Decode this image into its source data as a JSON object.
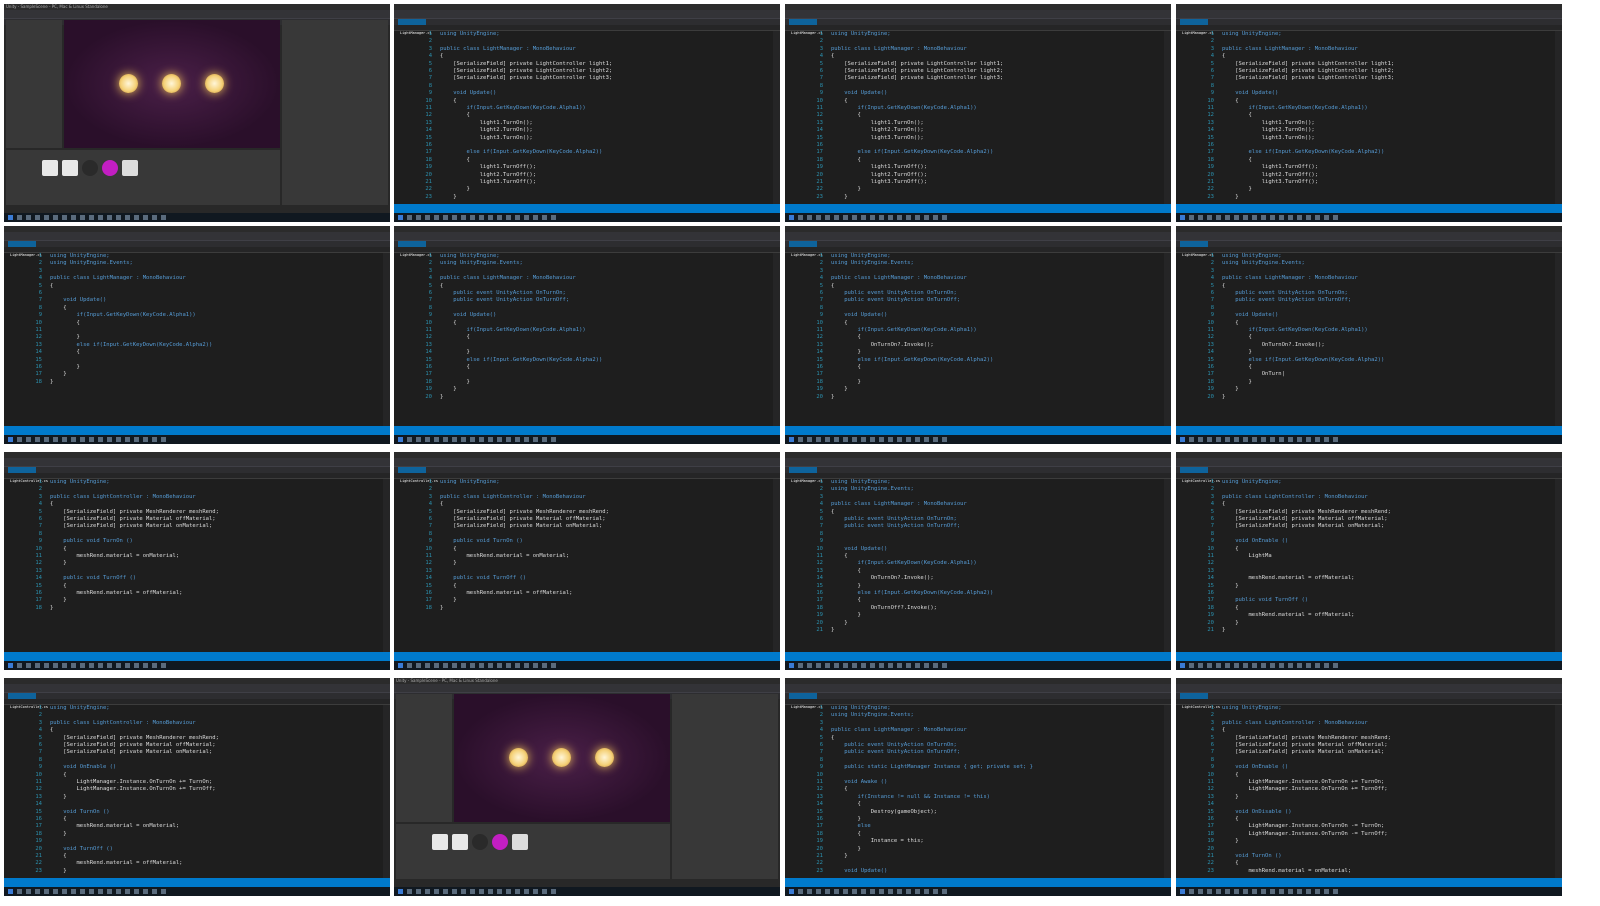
{
  "window": {
    "title": "LightManager.cs - Visual Studio"
  },
  "unity_tiles": [
    {
      "id": "unity-1",
      "title": "Unity - SampleScene - PC, Mac & Linux Standalone"
    },
    {
      "id": "unity-2",
      "title": "Unity - SampleScene - PC, Mac & Linux Standalone"
    }
  ],
  "code_tiles": [
    {
      "id": "code-1",
      "file": "LightManager.cs",
      "start": 1,
      "lines": [
        "using UnityEngine;",
        "",
        "public class LightManager : MonoBehaviour",
        "{",
        "    [SerializeField] private LightController light1;",
        "    [SerializeField] private LightController light2;",
        "    [SerializeField] private LightController light3;",
        "",
        "    void Update()",
        "    {",
        "        if(Input.GetKeyDown(KeyCode.Alpha1))",
        "        {",
        "            light1.TurnOn();",
        "            light2.TurnOn();",
        "            light3.TurnOn();",
        "",
        "        else if(Input.GetKeyDown(KeyCode.Alpha2))",
        "        {",
        "            light1.TurnOff();",
        "            light2.TurnOff();",
        "            light3.TurnOff();",
        "        }",
        "    }"
      ]
    },
    {
      "id": "code-2",
      "file": "LightManager.cs",
      "start": 1,
      "lines": [
        "using UnityEngine;",
        "",
        "public class LightManager : MonoBehaviour",
        "{",
        "    [SerializeField] private LightController light1;",
        "    [SerializeField] private LightController light2;",
        "    [SerializeField] private LightController light3;",
        "",
        "    void Update()",
        "    {",
        "        if(Input.GetKeyDown(KeyCode.Alpha1))",
        "        {",
        "            light1.TurnOn();",
        "            light2.TurnOn();",
        "            light3.TurnOn();",
        "",
        "        else if(Input.GetKeyDown(KeyCode.Alpha2))",
        "        {",
        "            light1.TurnOff();",
        "            light2.TurnOff();",
        "            light3.TurnOff();",
        "        }",
        "    }"
      ]
    },
    {
      "id": "code-3",
      "file": "LightManager.cs",
      "start": 1,
      "lines": [
        "using UnityEngine;",
        "",
        "public class LightManager : MonoBehaviour",
        "{",
        "    [SerializeField] private LightController light1;",
        "    [SerializeField] private LightController light2;",
        "    [SerializeField] private LightController light3;",
        "",
        "    void Update()",
        "    {",
        "        if(Input.GetKeyDown(KeyCode.Alpha1))",
        "        {",
        "            light1.TurnOn();",
        "            light2.TurnOn();",
        "            light3.TurnOn();",
        "",
        "        else if(Input.GetKeyDown(KeyCode.Alpha2))",
        "        {",
        "            light1.TurnOff();",
        "            light2.TurnOff();",
        "            light3.TurnOff();",
        "        }",
        "    }"
      ]
    },
    {
      "id": "code-4",
      "file": "LightManager.cs",
      "start": 1,
      "lines": [
        "using UnityEngine;",
        "using UnityEngine.Events;",
        "",
        "public class LightManager : MonoBehaviour",
        "{",
        "",
        "    void Update()",
        "    {",
        "        if(Input.GetKeyDown(KeyCode.Alpha1))",
        "        {",
        "",
        "        }",
        "        else if(Input.GetKeyDown(KeyCode.Alpha2))",
        "        {",
        "",
        "        }",
        "    }",
        "}"
      ]
    },
    {
      "id": "code-5",
      "file": "LightManager.cs",
      "start": 1,
      "lines": [
        "using UnityEngine;",
        "using UnityEngine.Events;",
        "",
        "public class LightManager : MonoBehaviour",
        "{",
        "    public event UnityAction OnTurnOn;",
        "    public event UnityAction OnTurnOff;",
        "",
        "    void Update()",
        "    {",
        "        if(Input.GetKeyDown(KeyCode.Alpha1))",
        "        {",
        "",
        "        }",
        "        else if(Input.GetKeyDown(KeyCode.Alpha2))",
        "        {",
        "",
        "        }",
        "    }",
        "}"
      ]
    },
    {
      "id": "code-6",
      "file": "LightManager.cs",
      "start": 1,
      "lines": [
        "using UnityEngine;",
        "using UnityEngine.Events;",
        "",
        "public class LightManager : MonoBehaviour",
        "{",
        "    public event UnityAction OnTurnOn;",
        "    public event UnityAction OnTurnOff;",
        "",
        "    void Update()",
        "    {",
        "        if(Input.GetKeyDown(KeyCode.Alpha1))",
        "        {",
        "            OnTurnOn?.Invoke();",
        "        }",
        "        else if(Input.GetKeyDown(KeyCode.Alpha2))",
        "        {",
        "",
        "        }",
        "    }",
        "}"
      ]
    },
    {
      "id": "code-7",
      "file": "LightManager.cs",
      "start": 1,
      "lines": [
        "using UnityEngine;",
        "using UnityEngine.Events;",
        "",
        "public class LightManager : MonoBehaviour",
        "{",
        "    public event UnityAction OnTurnOn;",
        "    public event UnityAction OnTurnOff;",
        "",
        "    void Update()",
        "    {",
        "        if(Input.GetKeyDown(KeyCode.Alpha1))",
        "        {",
        "            OnTurnOn?.Invoke();",
        "        }",
        "        else if(Input.GetKeyDown(KeyCode.Alpha2))",
        "        {",
        "            OnTurn|",
        "        }",
        "    }",
        "}"
      ]
    },
    {
      "id": "code-8",
      "file": "LightController.cs",
      "start": 1,
      "lines": [
        "using UnityEngine;",
        "",
        "public class LightController : MonoBehaviour",
        "{",
        "    [SerializeField] private MeshRenderer meshRend;",
        "    [SerializeField] private Material offMaterial;",
        "    [SerializeField] private Material onMaterial;",
        "",
        "    public void TurnOn ()",
        "    {",
        "        meshRend.material = onMaterial;",
        "    }",
        "",
        "    public void TurnOff ()",
        "    {",
        "        meshRend.material = offMaterial;",
        "    }",
        "}"
      ]
    },
    {
      "id": "code-9",
      "file": "LightController.cs",
      "start": 1,
      "lines": [
        "using UnityEngine;",
        "",
        "public class LightController : MonoBehaviour",
        "{",
        "    [SerializeField] private MeshRenderer meshRend;",
        "    [SerializeField] private Material offMaterial;",
        "    [SerializeField] private Material onMaterial;",
        "",
        "    public void TurnOn ()",
        "    {",
        "        meshRend.material = onMaterial;",
        "    }",
        "",
        "    public void TurnOff ()",
        "    {",
        "        meshRend.material = offMaterial;",
        "    }",
        "}"
      ]
    },
    {
      "id": "code-10",
      "file": "LightManager.cs",
      "start": 1,
      "lines": [
        "using UnityEngine;",
        "using UnityEngine.Events;",
        "",
        "public class LightManager : MonoBehaviour",
        "{",
        "    public event UnityAction OnTurnOn;",
        "    public event UnityAction OnTurnOff;",
        "",
        "",
        "    void Update()",
        "    {",
        "        if(Input.GetKeyDown(KeyCode.Alpha1))",
        "        {",
        "            OnTurnOn?.Invoke();",
        "        }",
        "        else if(Input.GetKeyDown(KeyCode.Alpha2))",
        "        {",
        "            OnTurnOff?.Invoke();",
        "        }",
        "    }",
        "}"
      ]
    },
    {
      "id": "code-11",
      "file": "LightController.cs",
      "start": 1,
      "lines": [
        "using UnityEngine;",
        "",
        "public class LightController : MonoBehaviour",
        "{",
        "    [SerializeField] private MeshRenderer meshRend;",
        "    [SerializeField] private Material offMaterial;",
        "    [SerializeField] private Material onMaterial;",
        "",
        "    void OnEnable ()",
        "    {",
        "        LightMa",
        "",
        "",
        "        meshRend.material = offMaterial;",
        "    }",
        "",
        "    public void TurnOff ()",
        "    {",
        "        meshRend.material = offMaterial;",
        "    }",
        "}"
      ]
    },
    {
      "id": "code-12",
      "file": "LightController.cs",
      "start": 1,
      "lines": [
        "using UnityEngine;",
        "",
        "public class LightController : MonoBehaviour",
        "{",
        "    [SerializeField] private MeshRenderer meshRend;",
        "    [SerializeField] private Material offMaterial;",
        "    [SerializeField] private Material onMaterial;",
        "",
        "    void OnEnable ()",
        "    {",
        "        LightManager.Instance.OnTurnOn += TurnOn;",
        "        LightManager.Instance.OnTurnOn += TurnOff;",
        "    }",
        "",
        "    void TurnOn ()",
        "    {",
        "        meshRend.material = onMaterial;",
        "    }",
        "",
        "    void TurnOff ()",
        "    {",
        "        meshRend.material = offMaterial;",
        "    }"
      ]
    },
    {
      "id": "code-13",
      "file": "LightManager.cs",
      "start": 1,
      "lines": [
        "using UnityEngine;",
        "using UnityEngine.Events;",
        "",
        "public class LightManager : MonoBehaviour",
        "{",
        "    public event UnityAction OnTurnOn;",
        "    public event UnityAction OnTurnOff;",
        "",
        "    public static LightManager Instance { get; private set; }",
        "",
        "    void Awake ()",
        "    {",
        "        if(Instance != null && Instance != this)",
        "        {",
        "            Destroy(gameObject);",
        "        }",
        "        else",
        "        {",
        "            Instance = this;",
        "        }",
        "    }",
        "",
        "    void Update()"
      ]
    },
    {
      "id": "code-14",
      "file": "LightController.cs",
      "start": 1,
      "lines": [
        "using UnityEngine;",
        "",
        "public class LightController : MonoBehaviour",
        "{",
        "    [SerializeField] private MeshRenderer meshRend;",
        "    [SerializeField] private Material offMaterial;",
        "    [SerializeField] private Material onMaterial;",
        "",
        "    void OnEnable ()",
        "    {",
        "        LightManager.Instance.OnTurnOn += TurnOn;",
        "        LightManager.Instance.OnTurnOn += TurnOff;",
        "    }",
        "",
        "    void OnDisable ()",
        "    {",
        "        LightManager.Instance.OnTurnOn -= TurnOn;",
        "        LightManager.Instance.OnTurnOn -= TurnOff;",
        "    }",
        "",
        "    void TurnOn ()",
        "    {",
        "        meshRend.material = onMaterial;"
      ]
    }
  ],
  "colors": {
    "keyword": "#569cd6",
    "type": "#4ec9b0",
    "line_number": "#2b91af",
    "status_bar": "#007acc"
  }
}
